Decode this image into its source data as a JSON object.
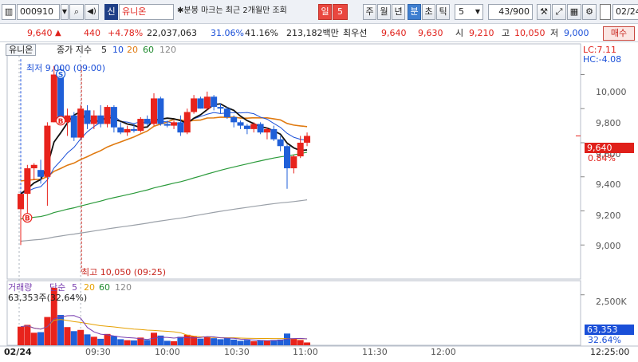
{
  "toolbar": {
    "code": "000910",
    "badge": "신",
    "name": "유니온",
    "mark_text": "분봉 마크는 최근 2개월만 조회",
    "periods": [
      "일",
      "5",
      "주",
      "월",
      "년",
      "분",
      "초",
      "틱"
    ],
    "interval": "5",
    "count": "43/900",
    "date": "02/24"
  },
  "quote": {
    "price": "9,640",
    "change": "440",
    "change_pct": "+4.78%",
    "volume": "22,037,063",
    "turnover_pct": "31.06%",
    "ratio_pct": "41.16%",
    "amount": "213,182백만",
    "best_label": "최우선",
    "ask": "9,640",
    "bid": "9,630",
    "open_label": "시",
    "open": "9,210",
    "high_label": "고",
    "high": "10,050",
    "low_label": "저",
    "low": "9,000",
    "trade_btn": "매수"
  },
  "chart_data": {
    "type": "candlestick",
    "title": "유니온",
    "indicator": "종가 지수",
    "ma_periods": [
      "5",
      "10",
      "20",
      "60",
      "120"
    ],
    "price_axis": {
      "ticks": [
        "10,000",
        "9,800",
        "9,600",
        "9,400",
        "9,200",
        "9,000"
      ],
      "ylim": [
        8800,
        10180
      ]
    },
    "volume_axis": {
      "ticks": [
        "2,500K"
      ],
      "ylim": [
        0,
        3200000
      ]
    },
    "x_ticks": [
      "02/24",
      "09:30",
      "10:00",
      "10:30",
      "11:00",
      "11:30",
      "12:00",
      "12:25:00"
    ],
    "lc": "LC:7.11",
    "hc": "HC:-4.08",
    "low_annotation": "최저 9,000 (09:00)",
    "high_annotation": "최고 10,050 (09:25)",
    "last_price_label": "9,640",
    "last_pct_label": "0.84%",
    "volume_title": "거래량",
    "volume_ma_label": "단순",
    "volume_ma_periods": [
      "5",
      "20",
      "60",
      "120"
    ],
    "volume_summary": "63,353주(32,64%)",
    "last_volume_label": "63,353",
    "last_volume_pct": "32.64%",
    "candles": [
      {
        "o": 9210,
        "h": 9300,
        "l": 9000,
        "c": 9300,
        "v": 920000
      },
      {
        "o": 9300,
        "h": 9470,
        "l": 9150,
        "c": 9450,
        "v": 1010000
      },
      {
        "o": 9450,
        "h": 9480,
        "l": 9380,
        "c": 9470,
        "v": 620000
      },
      {
        "o": 9440,
        "h": 9500,
        "l": 9360,
        "c": 9400,
        "v": 650000
      },
      {
        "o": 9400,
        "h": 9720,
        "l": 9230,
        "c": 9700,
        "v": 1400000
      },
      {
        "o": 9720,
        "h": 10050,
        "l": 9720,
        "c": 10000,
        "v": 2850000
      },
      {
        "o": 10000,
        "h": 10050,
        "l": 9720,
        "c": 9720,
        "v": 1500000
      },
      {
        "o": 9720,
        "h": 9800,
        "l": 9640,
        "c": 9760,
        "v": 900000
      },
      {
        "o": 9760,
        "h": 9780,
        "l": 9610,
        "c": 9630,
        "v": 700000
      },
      {
        "o": 9630,
        "h": 9820,
        "l": 9620,
        "c": 9800,
        "v": 760000
      },
      {
        "o": 9790,
        "h": 9820,
        "l": 9680,
        "c": 9710,
        "v": 540000
      },
      {
        "o": 9710,
        "h": 9790,
        "l": 9680,
        "c": 9760,
        "v": 420000
      },
      {
        "o": 9760,
        "h": 9820,
        "l": 9690,
        "c": 9710,
        "v": 320000
      },
      {
        "o": 9710,
        "h": 9820,
        "l": 9690,
        "c": 9810,
        "v": 560000
      },
      {
        "o": 9810,
        "h": 9820,
        "l": 9660,
        "c": 9690,
        "v": 460000
      },
      {
        "o": 9690,
        "h": 9720,
        "l": 9650,
        "c": 9660,
        "v": 300000
      },
      {
        "o": 9660,
        "h": 9700,
        "l": 9640,
        "c": 9680,
        "v": 250000
      },
      {
        "o": 9680,
        "h": 9710,
        "l": 9660,
        "c": 9670,
        "v": 240000
      },
      {
        "o": 9670,
        "h": 9750,
        "l": 9660,
        "c": 9740,
        "v": 380000
      },
      {
        "o": 9740,
        "h": 9760,
        "l": 9700,
        "c": 9710,
        "v": 260000
      },
      {
        "o": 9710,
        "h": 9890,
        "l": 9700,
        "c": 9860,
        "v": 620000
      },
      {
        "o": 9860,
        "h": 9870,
        "l": 9700,
        "c": 9710,
        "v": 480000
      },
      {
        "o": 9710,
        "h": 9730,
        "l": 9690,
        "c": 9700,
        "v": 220000
      },
      {
        "o": 9700,
        "h": 9730,
        "l": 9680,
        "c": 9720,
        "v": 200000
      },
      {
        "o": 9720,
        "h": 9760,
        "l": 9640,
        "c": 9660,
        "v": 420000
      },
      {
        "o": 9660,
        "h": 9800,
        "l": 9650,
        "c": 9780,
        "v": 520000
      },
      {
        "o": 9780,
        "h": 9880,
        "l": 9770,
        "c": 9860,
        "v": 450000
      },
      {
        "o": 9860,
        "h": 9870,
        "l": 9800,
        "c": 9800,
        "v": 330000
      },
      {
        "o": 9800,
        "h": 9900,
        "l": 9790,
        "c": 9870,
        "v": 430000
      },
      {
        "o": 9870,
        "h": 9880,
        "l": 9790,
        "c": 9810,
        "v": 350000
      },
      {
        "o": 9810,
        "h": 9830,
        "l": 9770,
        "c": 9800,
        "v": 300000
      },
      {
        "o": 9800,
        "h": 9810,
        "l": 9740,
        "c": 9750,
        "v": 360000
      },
      {
        "o": 9750,
        "h": 9760,
        "l": 9690,
        "c": 9720,
        "v": 280000
      },
      {
        "o": 9720,
        "h": 9730,
        "l": 9680,
        "c": 9700,
        "v": 220000
      },
      {
        "o": 9700,
        "h": 9710,
        "l": 9650,
        "c": 9680,
        "v": 260000
      },
      {
        "o": 9680,
        "h": 9720,
        "l": 9660,
        "c": 9710,
        "v": 200000
      },
      {
        "o": 9710,
        "h": 9720,
        "l": 9650,
        "c": 9660,
        "v": 240000
      },
      {
        "o": 9660,
        "h": 9690,
        "l": 9620,
        "c": 9680,
        "v": 220000
      },
      {
        "o": 9680,
        "h": 9700,
        "l": 9610,
        "c": 9620,
        "v": 260000
      },
      {
        "o": 9620,
        "h": 9640,
        "l": 9550,
        "c": 9580,
        "v": 280000
      },
      {
        "o": 9580,
        "h": 9590,
        "l": 9330,
        "c": 9450,
        "v": 580000
      },
      {
        "o": 9450,
        "h": 9530,
        "l": 9420,
        "c": 9520,
        "v": 320000
      },
      {
        "o": 9520,
        "h": 9640,
        "l": 9510,
        "c": 9600,
        "v": 260000
      },
      {
        "o": 9600,
        "h": 9660,
        "l": 9580,
        "c": 9640,
        "v": 140000
      }
    ],
    "markers": [
      {
        "index": 1,
        "type": "B"
      },
      {
        "index": 6,
        "type": "S"
      },
      {
        "index": 6,
        "type": "B"
      }
    ]
  }
}
